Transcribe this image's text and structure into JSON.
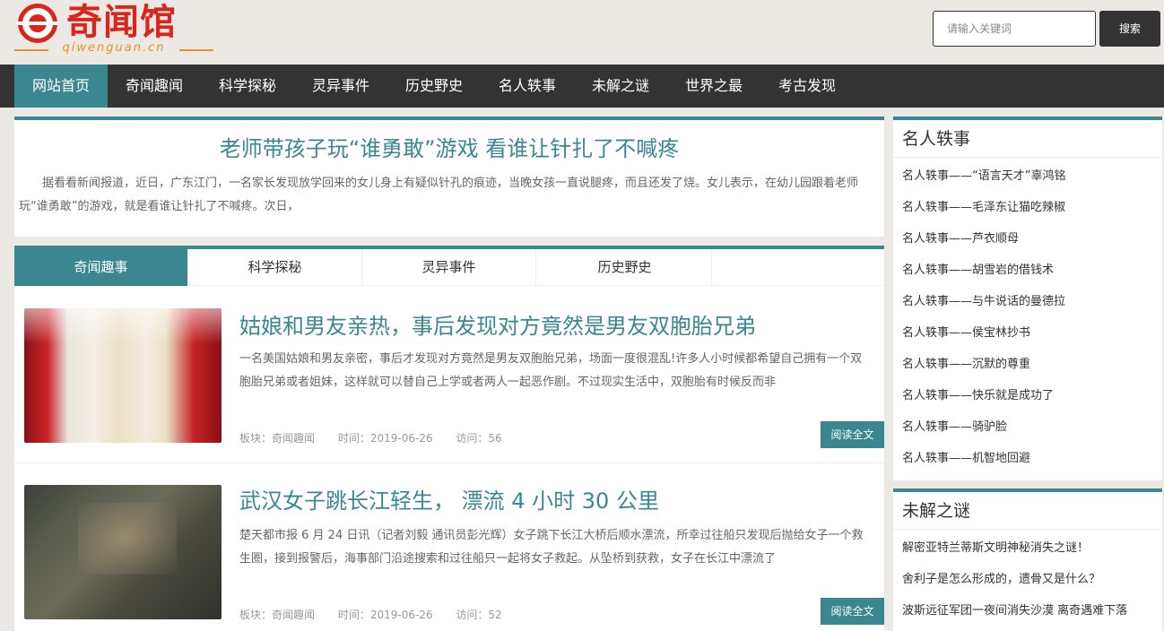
{
  "logo": {
    "text": "奇闻馆",
    "sub": "qiwenguan.cn"
  },
  "search": {
    "placeholder": "请输入关键词",
    "button": "搜索"
  },
  "nav": [
    "网站首页",
    "奇闻趣闻",
    "科学探秘",
    "灵异事件",
    "历史野史",
    "名人轶事",
    "未解之谜",
    "世界之最",
    "考古发现"
  ],
  "headline": {
    "title": "老师带孩子玩“谁勇敢”游戏 看谁让针扎了不喊疼",
    "text": "据看看新闻报道，近日，广东江门，一名家长发现放学回来的女儿身上有疑似针孔的痕迹，当晚女孩一直说腿疼，而且还发了烧。女儿表示，在幼儿园跟着老师玩“谁勇敢”的游戏，就是看谁让针扎了不喊疼。次日，"
  },
  "tabs": [
    "奇闻趣事",
    "科学探秘",
    "灵异事件",
    "历史野史"
  ],
  "articles": [
    {
      "title": "姑娘和男友亲热，事后发现对方竟然是男友双胞胎兄弟",
      "desc": "一名美国姑娘和男友亲密，事后才发现对方竟然是男友双胞胎兄弟，场面一度很混乱!许多人小时候都希望自己拥有一个双胞胎兄弟或者姐妹，这样就可以替自己上学或者两人一起恶作剧。不过现实生活中，双胞胎有时候反而非",
      "board": "板块：奇闻趣闻",
      "time": "时间：2019-06-26",
      "visits": "访问：56",
      "read": "阅读全文"
    },
    {
      "title": "武汉女子跳长江轻生， 漂流 4 小时 30 公里",
      "desc": "楚天都市报 6 月 24 日讯（记者刘毅 通讯员彭光辉）女子跳下长江大桥后顺水漂流，所幸过往船只发现后抛给女子一个救生圈，接到报警后，海事部门沿途搜索和过往船只一起将女子救起。从坠桥到获救，女子在长江中漂流了",
      "board": "板块：奇闻趣闻",
      "time": "时间：2019-06-26",
      "visits": "访问：52",
      "read": "阅读全文"
    }
  ],
  "sidebar": {
    "celebs": {
      "title": "名人轶事",
      "items": [
        "名人轶事——“语言天才”辜鸿铭",
        "名人轶事——毛泽东让猫吃辣椒",
        "名人轶事——芦衣顺母",
        "名人轶事——胡雪岩的借钱术",
        "名人轶事——与牛说话的曼德拉",
        "名人轶事——侯宝林抄书",
        "名人轶事——沉默的尊重",
        "名人轶事——快乐就是成功了",
        "名人轶事——骑驴脸",
        "名人轶事——机智地回避"
      ]
    },
    "mysteries": {
      "title": "未解之谜",
      "items": [
        "解密亚特兰蒂斯文明神秘消失之谜！",
        "舍利子是怎么形成的，遗骨又是什么？",
        "波斯远征军团一夜间消失沙漠 离奇遇难下落"
      ]
    }
  }
}
